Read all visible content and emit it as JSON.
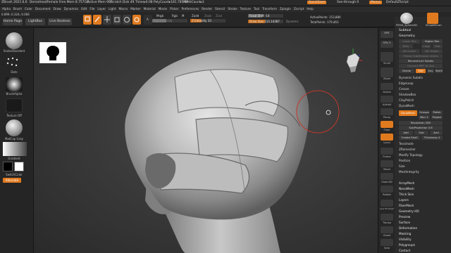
{
  "titlebar": {
    "app": "ZBrush 2021.6.6",
    "doc": "DemoHeadFemale",
    "free_mem": "Free Mem 8.757GB",
    "active_mem": "Active Mem 907",
    "scratch": "Scratch Disk 49",
    "timer": "Timer▸0.08",
    "polycount": "PolyCount▸181.785 KP",
    "meshcount": "MeshCount▸3",
    "quicksave": "QuickSave",
    "seethrough": "See-through 0",
    "menus": "Menus",
    "script": "DefaultZScript"
  },
  "menubar": [
    "Alpha",
    "Brush",
    "Color",
    "Document",
    "Draw",
    "Dynamics",
    "Edit",
    "File",
    "Layer",
    "Light",
    "Macro",
    "Marker",
    "Material",
    "Movie",
    "Picker",
    "Preferences",
    "Render",
    "Stencil",
    "Stroke",
    "Texture",
    "Tool",
    "Transform",
    "Zplugin",
    "Zscript",
    "Help"
  ],
  "toolbar": {
    "coords": "0.899,-0.324,-0.066",
    "home": "Home Page",
    "lightbox": "LightBox",
    "live_boolean": "Live Boolean",
    "edit": "Edit",
    "draw": "Draw",
    "move": "Move",
    "scale": "Scale",
    "rotate": "Rotate",
    "a_label": "A",
    "mrgb": "Mrgb",
    "rgb": "Rgb",
    "m": "M",
    "zadd": "Zadd",
    "zsub": "Zsub",
    "zcut": "Zcut",
    "rgb_intensity": "Rgb Intensity",
    "z_intensity": "Z Intensity 33",
    "focal_shift": "Focal Shift -14",
    "draw_size": "Draw Size 113.14387",
    "dynamic": "Dynamic",
    "active_points": "ActivePoints: 153,880",
    "total_points": "TotalPoints: 179,463"
  },
  "leftpanel": {
    "brush_label": "SnakeStandard",
    "dots_label": "Dots",
    "alpha_label": "BrushAlpha",
    "texture_label": "Texture Off",
    "material_label": "MatCap Gray",
    "gradient_label": "Gradient",
    "switch_label": "SwitchColor",
    "alternate_label": "Alternate"
  },
  "shelf": [
    "BPR",
    "SPix 3",
    "Scroll",
    "Zoom",
    "Actual",
    "AAHalf",
    "Persp",
    "Floor",
    "Local",
    "Frame",
    "Move",
    "Zoom3D",
    "Rotate",
    "Line Fill PolyF",
    "Transp",
    "Ghost",
    "Solo",
    "Xpose"
  ],
  "palette": {
    "top_buttons": [
      "PM3D_Sphere3D",
      "SimpleBrush"
    ],
    "subtool": "Subtool",
    "geometry": "Geometry",
    "lower_res": "Lower Res",
    "higher_res": "Higher Res",
    "sdiv": "SDiv",
    "cage": "Cage",
    "rstr": "Rstr",
    "del_lower": "Del Lower",
    "del_higher": "Del Higher",
    "freeze": "Freeze SubDivision Levels",
    "reconstruct": "Reconstruct Subdiv",
    "convert": "Convert BPR To Geo",
    "divide": "Divide",
    "smt": "Smt",
    "suv": "Suv",
    "reuv": "ReUV",
    "dynamic_subdiv": "Dynamic Subdiv",
    "edgeloop": "EdgeLoop",
    "crease": "Crease",
    "shadowbox": "ShadowBox",
    "claypolish": "ClayPolish",
    "dynamesh_section": "DynaMesh",
    "dynamesh_btn": "DynaMesh",
    "groups": "Groups",
    "polish": "Polish",
    "blur": "Blur 2",
    "project": "Project",
    "resolution": "Resolution 280",
    "subprojection": "SubProjection 0.6",
    "add": "Add",
    "sub": "Sub",
    "and": "And",
    "create_shell": "Create Shell",
    "thickness": "Thickness 4",
    "tessimate": "Tessimate",
    "zremesher": "ZRemesher",
    "modify_topology": "Modify Topology",
    "position": "Position",
    "size": "Size",
    "meshintegrity": "MeshIntegrity",
    "sections": [
      "ArrayMesh",
      "NanoMesh",
      "Thick Skin",
      "Layers",
      "FiberMesh",
      "Geometry HD",
      "Preview",
      "Surface",
      "Deformation",
      "Masking",
      "Visibility",
      "Polygroups",
      "Contact"
    ]
  },
  "colors": {
    "accent": "#e07a1f",
    "panel": "#2b2b2b",
    "viewport": "#3a3a3a",
    "cursor_ring": "#c0392b"
  }
}
